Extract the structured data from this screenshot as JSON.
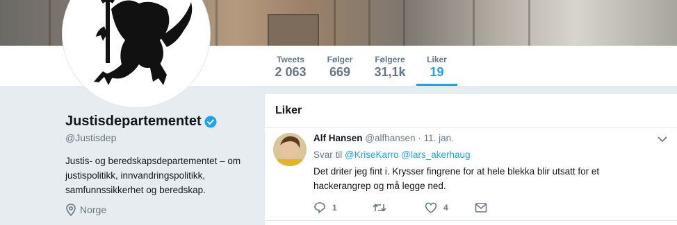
{
  "stats": [
    {
      "label": "Tweets",
      "value": "2 063"
    },
    {
      "label": "Følger",
      "value": "669"
    },
    {
      "label": "Følgere",
      "value": "31,1k"
    },
    {
      "label": "Liker",
      "value": "19"
    }
  ],
  "active_tab": "Liker",
  "profile": {
    "name": "Justisdepartementet",
    "handle": "@Justisdep",
    "bio": "Justis- og beredskapsdepartementet – om justispolitikk, innvandringspolitikk, samfunnssikkerhet og beredskap.",
    "location": "Norge"
  },
  "panel": {
    "title": "Liker"
  },
  "tweet": {
    "author_name": "Alf Hansen",
    "author_handle": "@alfhansen",
    "separator": "·",
    "date": "11. jan.",
    "reply_prefix": "Svar til",
    "reply_mentions": [
      "@KriseKarro",
      "@lars_akerhaug"
    ],
    "text": "Det driter jeg fint i. Krysser fingrene for at hele blekka blir utsatt for et hackerangrep og må legge ned.",
    "reply_count": "1",
    "retweet_count": "",
    "like_count": "4"
  },
  "colors": {
    "accent": "#1da1f2",
    "muted": "#657786",
    "background": "#e6ecf0"
  },
  "icons": [
    "verified-badge-icon",
    "location-pin-icon",
    "chevron-down-icon",
    "reply-icon",
    "retweet-icon",
    "heart-icon",
    "message-icon"
  ]
}
